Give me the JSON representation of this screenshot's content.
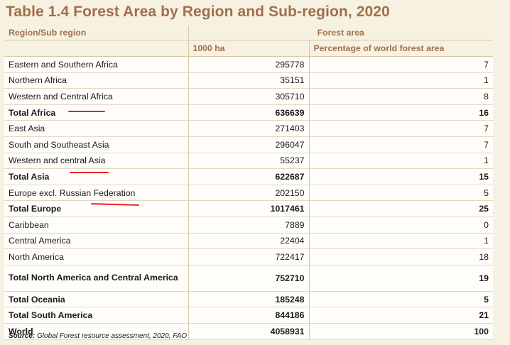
{
  "title": "Table 1.4 Forest Area by Region and Sub-region, 2020",
  "header": {
    "region_label": "Region/Sub region",
    "group_label": "Forest area",
    "col_ha": "1000 ha",
    "col_pct": "Percentage of world forest area"
  },
  "rows": [
    {
      "name": "Eastern and Southern Africa",
      "ha": "295778",
      "pct": "7"
    },
    {
      "name": "Northern Africa",
      "ha": "35151",
      "pct": "1"
    },
    {
      "name": "Western and Central Africa",
      "ha": "305710",
      "pct": "8"
    },
    {
      "name": "Total Africa",
      "ha": "636639",
      "pct": "16"
    },
    {
      "name": "East Asia",
      "ha": "271403",
      "pct": "7"
    },
    {
      "name": "South and Southeast Asia",
      "ha": "296047",
      "pct": "7"
    },
    {
      "name": "Western and central Asia",
      "ha": "55237",
      "pct": "1"
    },
    {
      "name": "Total Asia",
      "ha": "622687",
      "pct": "15"
    },
    {
      "name": "Europe excl. Russian Federation",
      "ha": "202150",
      "pct": "5"
    },
    {
      "name": "Total Europe",
      "ha": "1017461",
      "pct": "25"
    },
    {
      "name": "Caribbean",
      "ha": "7889",
      "pct": "0"
    },
    {
      "name": "Central America",
      "ha": "22404",
      "pct": "1"
    },
    {
      "name": "North America",
      "ha": "722417",
      "pct": "18"
    },
    {
      "name": "Total North America and Central America",
      "ha": "752710",
      "pct": "19"
    },
    {
      "name": "Total Oceania",
      "ha": "185248",
      "pct": "5"
    },
    {
      "name": "Total South America",
      "ha": "844186",
      "pct": "21"
    },
    {
      "name": "World",
      "ha": "4058931",
      "pct": "100"
    }
  ],
  "source": {
    "label": "Source:",
    "text": " Global Forest resource assessment, 2020, FAO"
  },
  "annotation_color": "#e8202a"
}
